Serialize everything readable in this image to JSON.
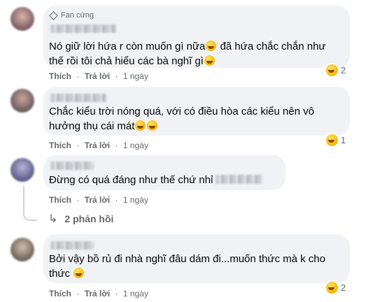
{
  "comments": [
    {
      "badge": "Fan cứng",
      "lines": [
        "Nó giữ lời hứa r còn muốn gì nữa",
        "đã hứa chắc chắn như",
        "thế rồi tôi chả hiểu các bà nghĩ gì"
      ],
      "like": "Thích",
      "reply": "Trả lời",
      "time": "1 ngày",
      "reaction_count": "2",
      "reaction_icon": "laughing-emoji-icon"
    },
    {
      "lines": [
        "Chắc kiểu trời nóng quá, với có điều hòa các kiểu nên vô",
        "hưởng thụ cái mát"
      ],
      "like": "Thích",
      "reply": "Trả lời",
      "time": "1 ngày",
      "reaction_count": "1",
      "reaction_icon": "laughing-emoji-icon"
    },
    {
      "lines": [
        "Đừng có quá đáng như thế chứ nhỉ"
      ],
      "like": "Thích",
      "reply": "Trả lời",
      "time": "1 ngày",
      "replies_label": "2 phản hồi"
    },
    {
      "lines": [
        "Bởi vậy bồ rủ đi nhà nghĩ đâu dám đi...muốn thức mà k cho",
        "thức"
      ],
      "like": "Thích",
      "reply": "Trả lời",
      "time": "1 ngày",
      "reaction_count": "2",
      "reaction_icon": "laughing-emoji-icon"
    }
  ],
  "separator": "·",
  "colors": {
    "bubble": "#f0f2f5",
    "meta": "#65676b",
    "text": "#050505"
  }
}
